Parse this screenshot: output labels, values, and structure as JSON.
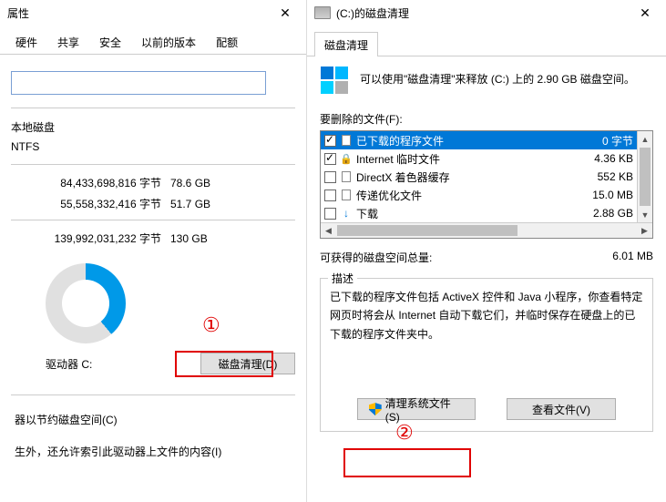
{
  "left": {
    "title": "属性",
    "tabs": [
      "硬件",
      "共享",
      "安全",
      "以前的版本",
      "配额"
    ],
    "type_label": "本地磁盘",
    "fs_label": "NTFS",
    "rows": [
      {
        "bytes": "84,433,698,816 字节",
        "human": "78.6 GB"
      },
      {
        "bytes": "55,558,332,416 字节",
        "human": "51.7 GB"
      }
    ],
    "total": {
      "bytes": "139,992,031,232 字节",
      "human": "130 GB"
    },
    "drive_label": "驱动器 C:",
    "cleanup_btn": "磁盘清理(D)",
    "footer1": "器以节约磁盘空间(C)",
    "footer2": "生外，还允许索引此驱动器上文件的内容(I)",
    "annotation1": "①"
  },
  "right": {
    "title": "(C:)的磁盘清理",
    "tab": "磁盘清理",
    "info_text": "可以使用\"磁盘清理\"来释放  (C:) 上的 2.90 GB 磁盘空间。",
    "files_label": "要删除的文件(F):",
    "items": [
      {
        "checked": true,
        "icon": "file",
        "name": "已下载的程序文件",
        "size": "0 字节",
        "selected": true
      },
      {
        "checked": true,
        "icon": "lock",
        "name": "Internet 临时文件",
        "size": "4.36 KB",
        "selected": false
      },
      {
        "checked": false,
        "icon": "file",
        "name": "DirectX 着色器缓存",
        "size": "552 KB",
        "selected": false
      },
      {
        "checked": false,
        "icon": "file",
        "name": "传递优化文件",
        "size": "15.0 MB",
        "selected": false
      },
      {
        "checked": false,
        "icon": "arrow",
        "name": "下载",
        "size": "2.88 GB",
        "selected": false
      }
    ],
    "gain_label": "可获得的磁盘空间总量:",
    "gain_value": "6.01 MB",
    "desc_title": "描述",
    "desc_body": "已下载的程序文件包括 ActiveX 控件和 Java 小程序，你查看特定网页时将会从 Internet 自动下载它们，并临时保存在硬盘上的已下载的程序文件夹中。",
    "btn_clean_sys": "清理系统文件(S)",
    "btn_view": "查看文件(V)",
    "annotation2": "②"
  }
}
